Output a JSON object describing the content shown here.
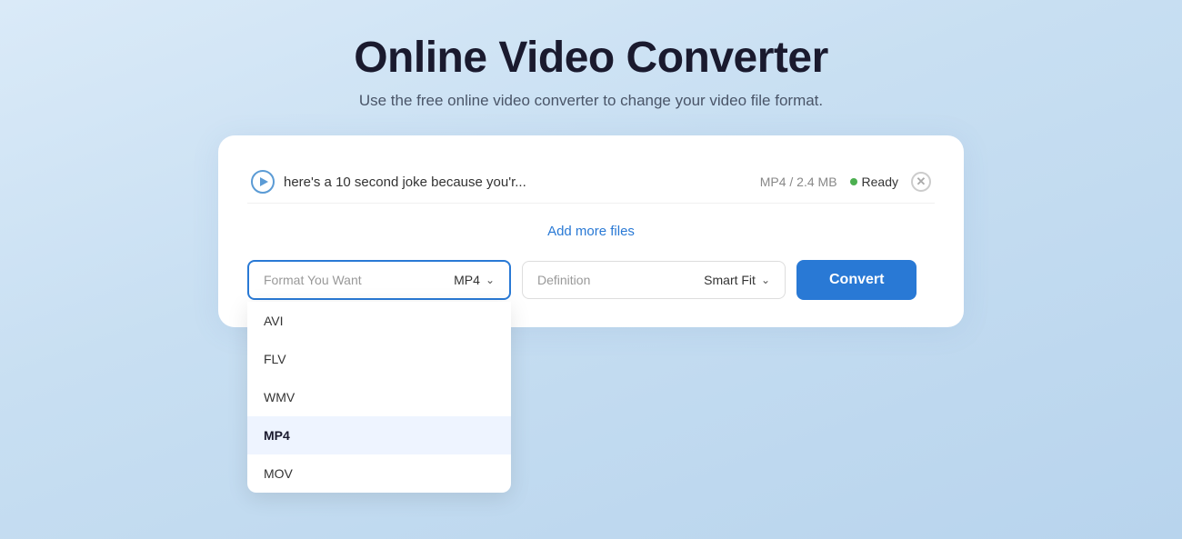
{
  "header": {
    "title": "Online Video Converter",
    "subtitle": "Use the free online video converter to change your video file format."
  },
  "file": {
    "name": "here's a 10 second joke because you'r...",
    "meta": "MP4 / 2.4 MB",
    "status": "Ready"
  },
  "add_files_link": "Add more files",
  "format_selector": {
    "label": "Format You Want",
    "selected": "MP4",
    "options": [
      "AVI",
      "FLV",
      "WMV",
      "MP4",
      "MOV"
    ]
  },
  "definition_selector": {
    "label": "Definition",
    "selected": "Smart Fit"
  },
  "convert_button": "Convert",
  "icons": {
    "play": "▶",
    "close": "✕",
    "chevron_down": "∨"
  }
}
